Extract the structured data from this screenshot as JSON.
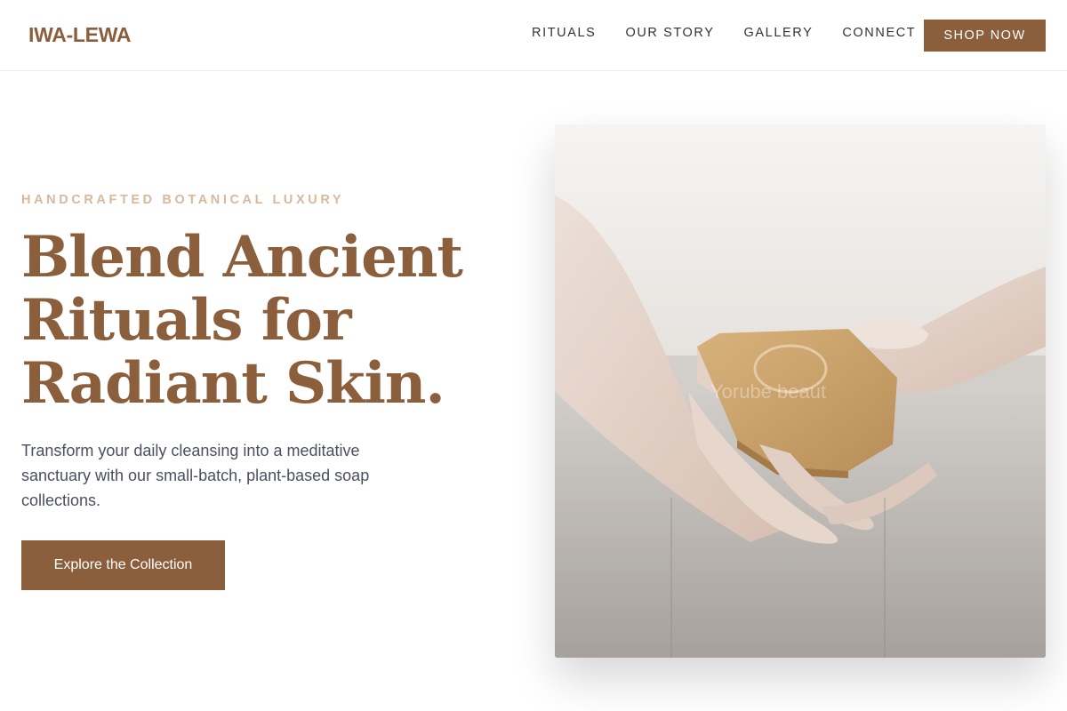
{
  "nav": {
    "logo": "IWA-LEWA",
    "links": [
      {
        "label": "RITUALS"
      },
      {
        "label": "OUR STORY"
      },
      {
        "label": "GALLERY"
      },
      {
        "label": "CONNECT"
      }
    ],
    "cta_label": "SHOP NOW"
  },
  "hero": {
    "eyebrow": "HANDCRAFTED BOTANICAL LUXURY",
    "headline_lines": [
      "Blend Ancient",
      "Rituals for",
      "Radiant Skin."
    ],
    "subtext": "Transform your daily cleansing into a meditative sanctuary with our small-batch, plant-based soap collections.",
    "cta_label": "Explore the Collection",
    "image_watermark": "Yorube beaut"
  },
  "colors": {
    "brand": "#8b5e3c",
    "eyebrow": "#d9b89b",
    "body_text": "#4a5060"
  }
}
